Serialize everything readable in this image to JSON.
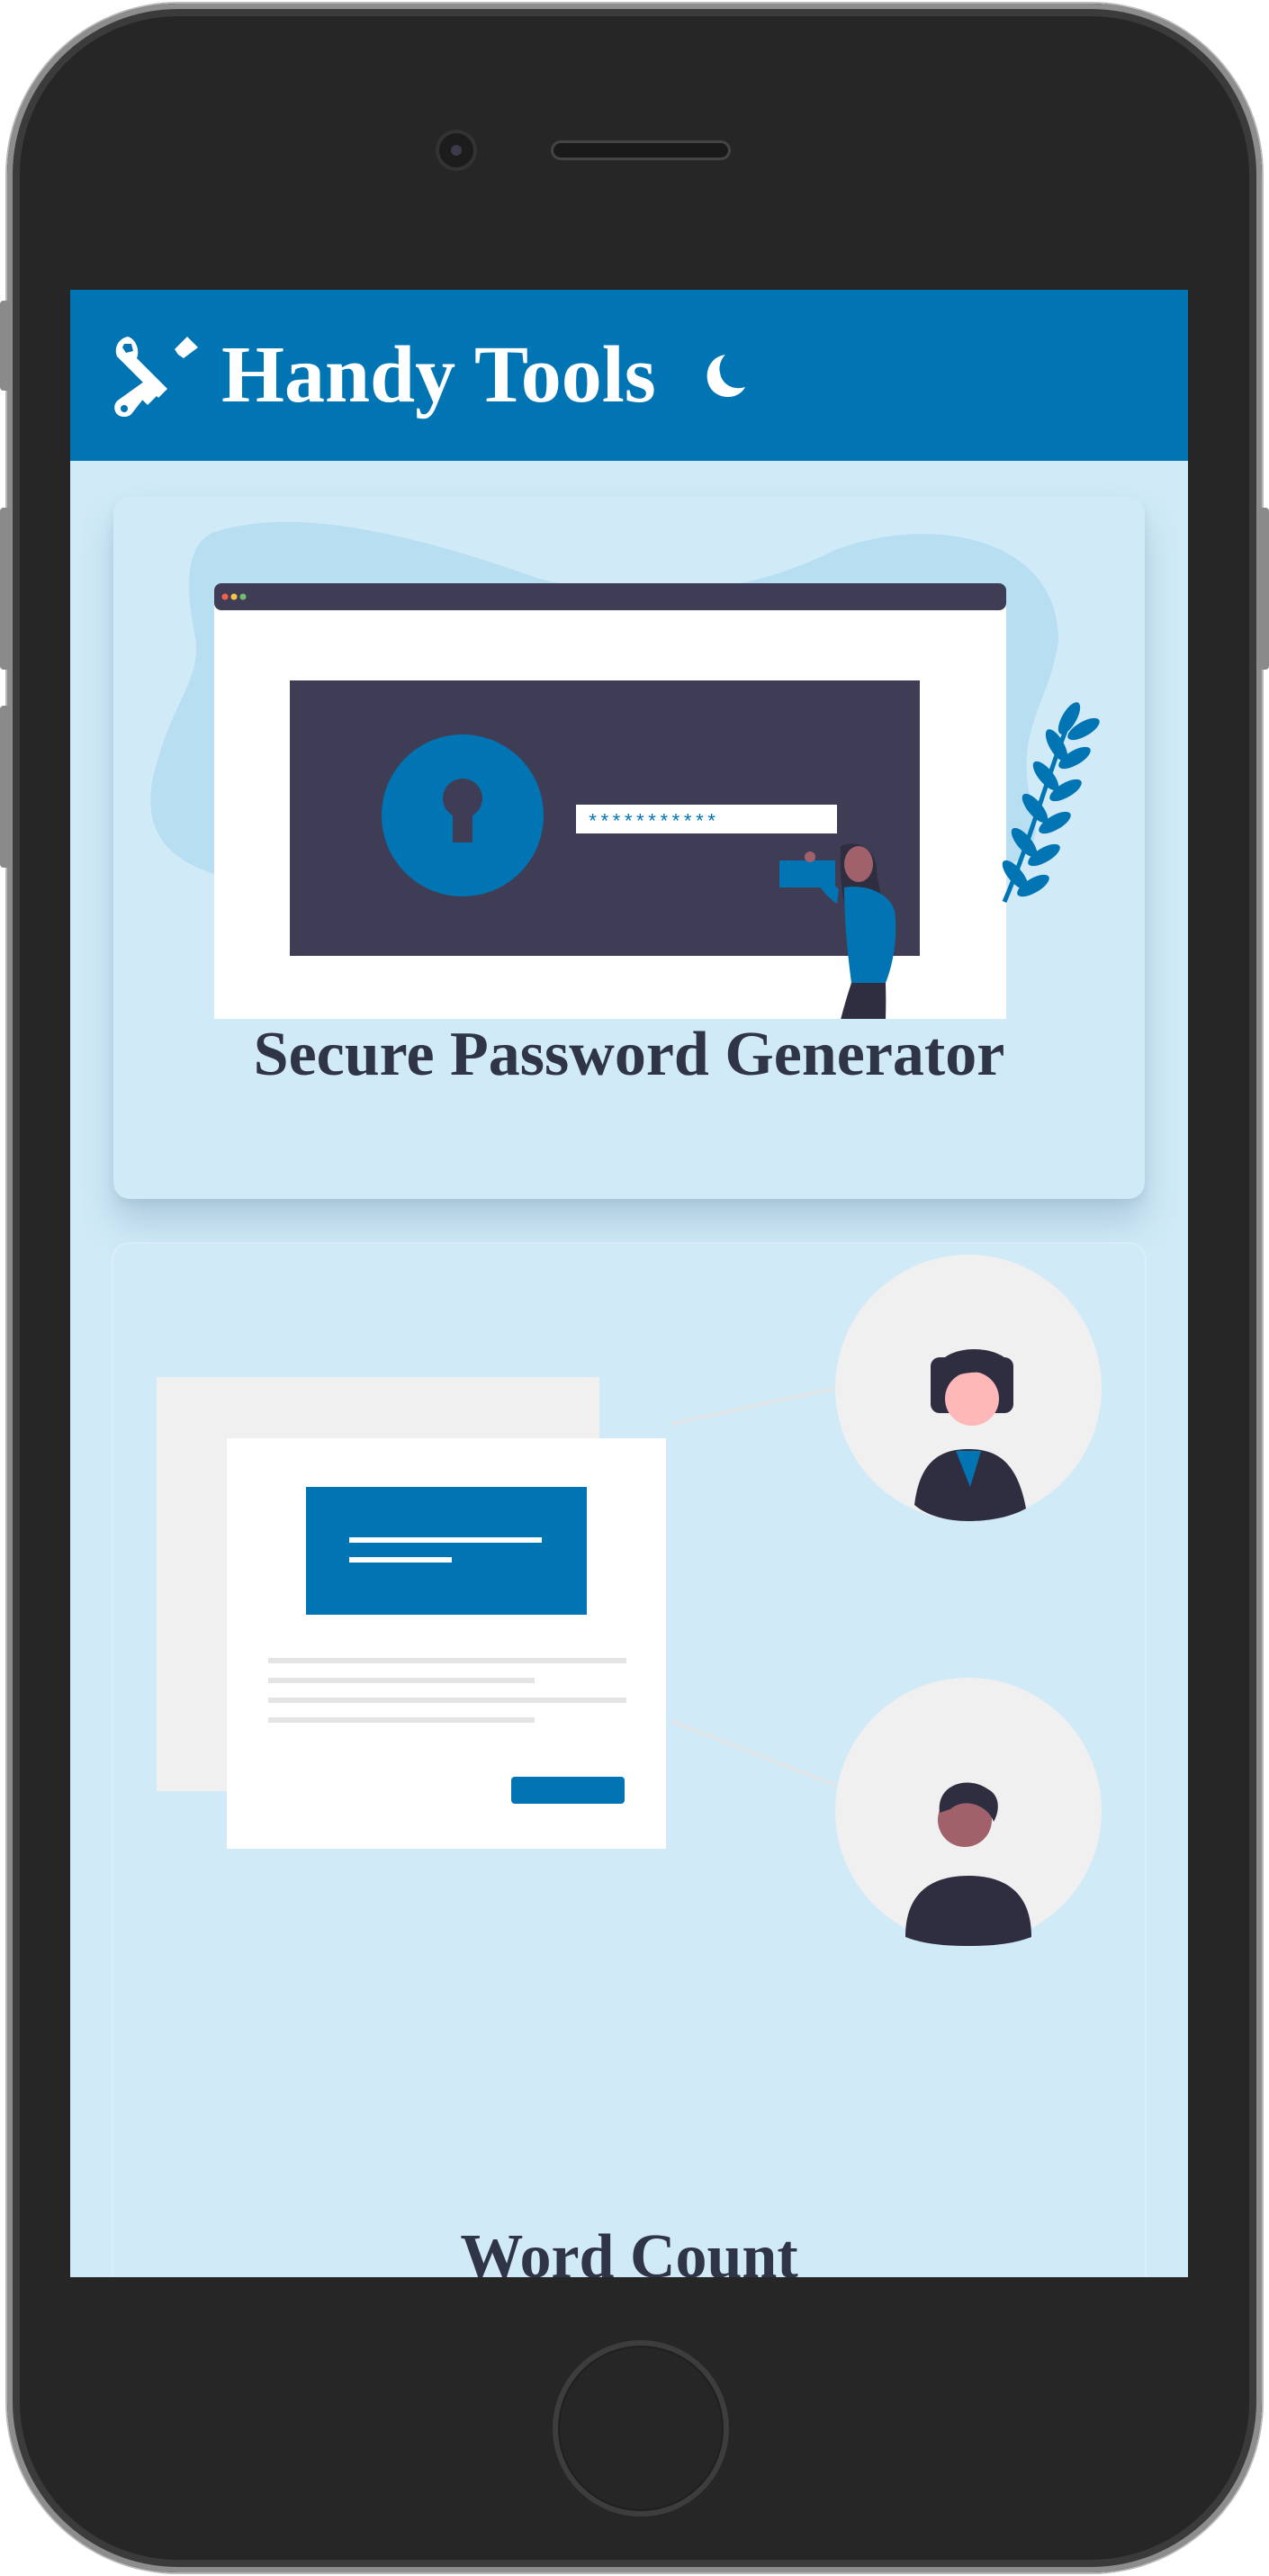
{
  "app": {
    "title": "Handy Tools",
    "logo_icon": "tools-icon",
    "theme_toggle_icon": "moon-icon"
  },
  "cards": [
    {
      "title": "Secure Password Generator",
      "illustration": "password-illustration",
      "password_mask": "***********"
    },
    {
      "title": "Word Count",
      "illustration": "document-sharing-illustration"
    }
  ],
  "colors": {
    "header": "#0175b4",
    "screen_bg": "#d0eaf7",
    "accent": "#0175b4",
    "dark": "#3f3d56",
    "title_text": "#2f3446"
  }
}
